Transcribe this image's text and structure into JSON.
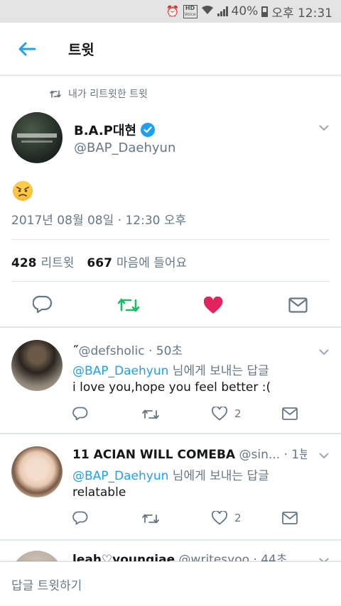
{
  "status_bar": {
    "battery": "40%",
    "time": "오후 12:31",
    "hd_label": "HD",
    "voice_label": "Voice"
  },
  "app_bar": {
    "title": "트윗"
  },
  "retweet_context": {
    "text": "내가 리트윗한 트윗"
  },
  "tweet": {
    "author_name": "B.A.P대현",
    "author_handle": "@BAP_Daehyun",
    "content_emoji": "angry-face",
    "timestamp": "2017년 08월 08일 · 12:30 오후",
    "retweets": {
      "count": "428",
      "label": "리트윗"
    },
    "likes": {
      "count": "667",
      "label": "마음에 들어요"
    },
    "liked": true
  },
  "replies": [
    {
      "name": "˝",
      "handle": "@defsholic",
      "time": "· 50초",
      "reply_to_mention": "@BAP_Daehyun",
      "reply_to_suffix": " 님에게 보내는 답글",
      "text": "i love you,hope you feel better :(",
      "likes": "2"
    },
    {
      "name": "11 ACIAN WILL COMEBA",
      "handle": "@sin...",
      "time": "· 1분",
      "reply_to_mention": "@BAP_Daehyun",
      "reply_to_suffix": " 님에게 보내는 답글",
      "text": "relatable",
      "likes": "2"
    },
    {
      "name": "leah♡youngjae",
      "handle": "@writesyoo",
      "time": "· 44초"
    }
  ],
  "compose": {
    "placeholder": "답글 트윗하기"
  },
  "colors": {
    "accent": "#1da1f2",
    "retweet_green": "#17bf63",
    "like_red": "#e0245e",
    "muted": "#657786"
  }
}
